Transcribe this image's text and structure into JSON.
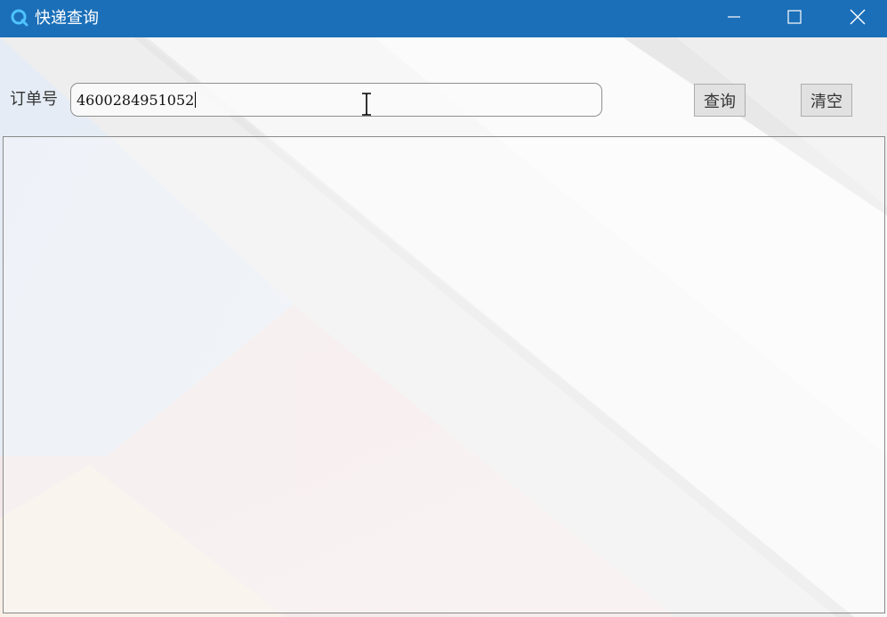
{
  "window": {
    "title": "快递查询",
    "titlebar_color": "#1b6fb8"
  },
  "icons": {
    "app": "app-search-icon",
    "minimize": "minimize-icon",
    "maximize": "maximize-icon",
    "close": "close-icon",
    "cursor": "text-cursor-icon"
  },
  "form": {
    "order_label": "订单号",
    "order_value": "4600284951052",
    "query_button": "查询",
    "clear_button": "清空"
  },
  "result": {
    "text": ""
  }
}
